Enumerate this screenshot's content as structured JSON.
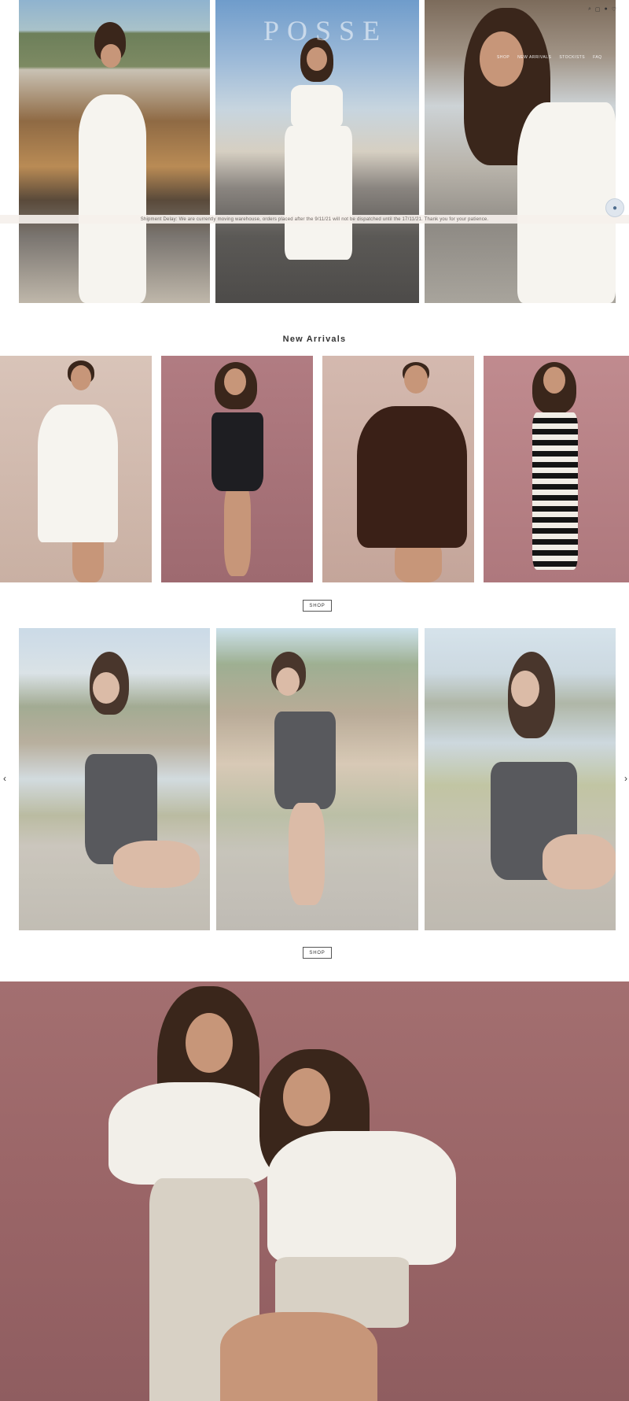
{
  "header": {
    "brand": "POSSE",
    "nav": [
      "SHOP",
      "NEW ARRIVALS",
      "STOCKISTS",
      "FAQ"
    ],
    "icons": [
      "search-icon",
      "cart-icon",
      "account-icon",
      "wishlist-icon"
    ]
  },
  "announcement": {
    "text": "Shipment Delay: We are currently moving warehouse, orders placed after the 9/11/21 will not be dispatched until the 17/11/21. Thank you for your patience."
  },
  "new_arrivals": {
    "title": "New Arrivals",
    "shop_label": "SHOP"
  },
  "carousel": {
    "shop_label": "SHOP",
    "prev_icon": "‹",
    "next_icon": "›"
  },
  "chat": {
    "icon": "chat-icon"
  },
  "colors": {
    "background": "#ffffff",
    "campaign_bg": "#9a6567",
    "announce_bg": "#f5f0ec"
  }
}
